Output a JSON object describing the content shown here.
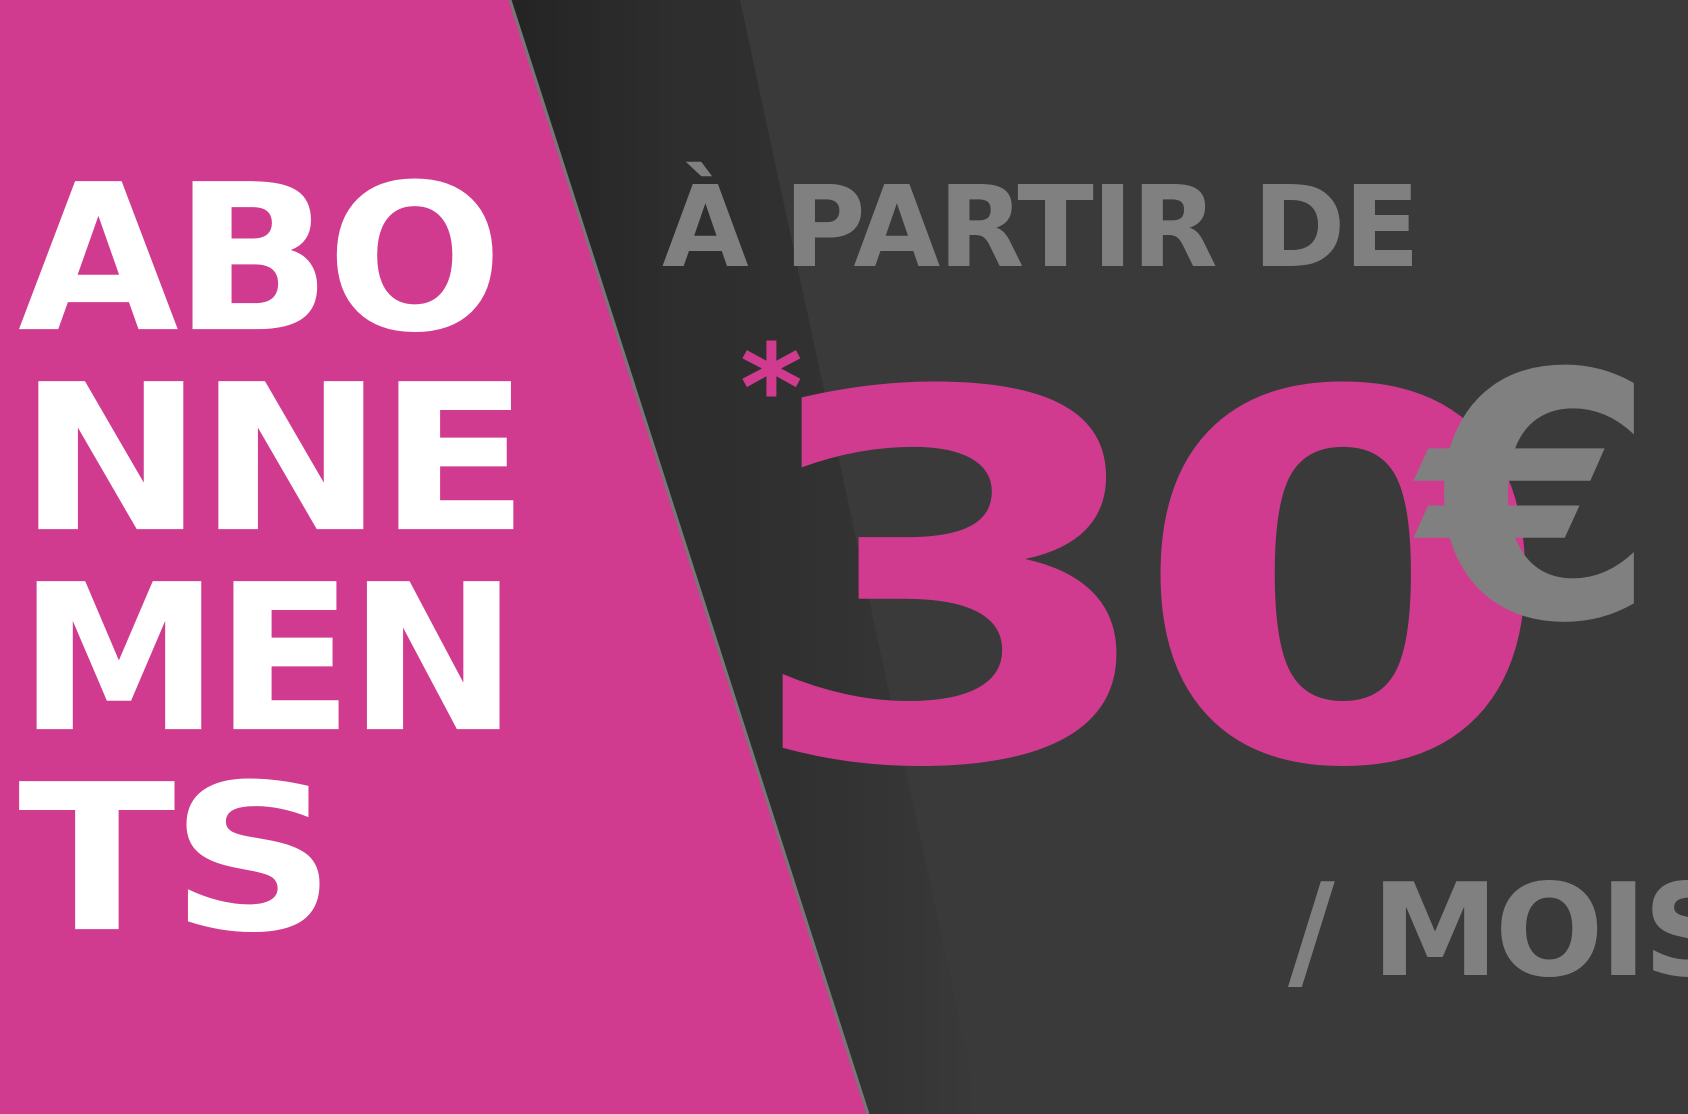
{
  "banner": {
    "headline": {
      "lines": [
        "ABO",
        "NNE",
        "MEN",
        "TS"
      ]
    },
    "offer": {
      "from_label": "À PARTIR DE",
      "asterisk": "*",
      "price": "30",
      "currency": "€",
      "period": "/ MOIS"
    },
    "colors": {
      "pink": "#d13b8f",
      "dark": "#3a3a3a",
      "gray": "#808080",
      "white": "#ffffff"
    }
  }
}
